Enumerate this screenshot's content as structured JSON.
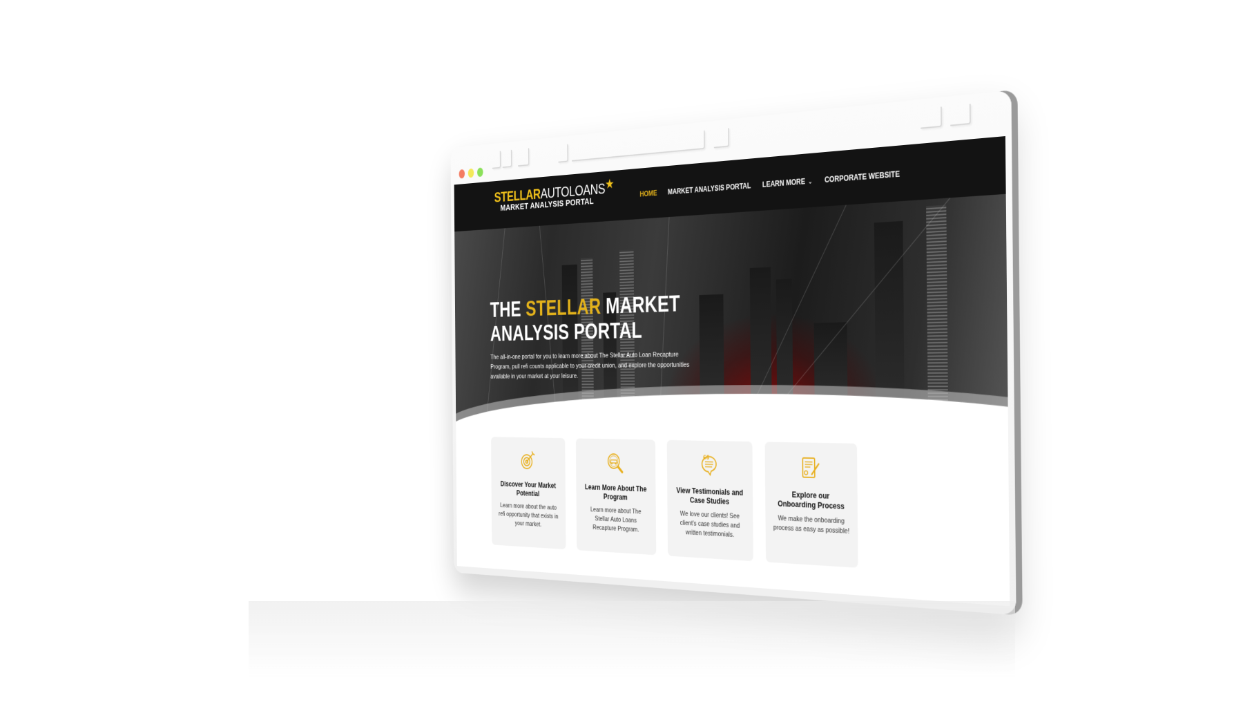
{
  "window": {
    "traffic_lights": [
      "close",
      "minimize",
      "maximize"
    ]
  },
  "nav": {
    "logo": {
      "brand_gold": "STELLAR",
      "brand_white": "AUTOLOANS",
      "star_icon": "★",
      "subtitle": "MARKET ANALYSIS PORTAL"
    },
    "items": [
      {
        "label": "HOME",
        "active": true
      },
      {
        "label": "MARKET ANALYSIS PORTAL",
        "active": false
      },
      {
        "label": "LEARN MORE",
        "active": false,
        "dropdown_icon": "⌄"
      },
      {
        "label": "CORPORATE WEBSITE",
        "active": false
      }
    ]
  },
  "hero": {
    "title_prefix": "THE ",
    "title_highlight": "STELLAR",
    "title_suffix": " MARKET ANALYSIS PORTAL",
    "subtitle": "The all-in-one portal for you to learn more about The Stellar Auto Loan Recapture Program, pull refi counts applicable to your credit union, and explore the opportunities available in your market at your leisure."
  },
  "cards": [
    {
      "icon": "target-icon",
      "title": "Discover Your Market Potential",
      "description": "Learn more about the auto refi opportunity that exists in your market."
    },
    {
      "icon": "magnifier-car-icon",
      "title": "Learn More About The Program",
      "description": "Learn more about The Stellar Auto Loans Recapture Program."
    },
    {
      "icon": "testimonial-bubble-icon",
      "title": "View Testimonials and Case Studies",
      "description": "We love our clients! See client's case studies and written testimonials."
    },
    {
      "icon": "contract-sign-icon",
      "title": "Explore our Onboarding Process",
      "description": "We make the onboarding process as easy as possible!"
    }
  ],
  "colors": {
    "accent_gold": "#e3b21b",
    "nav_bg": "#131313",
    "card_bg": "#f3f3f3"
  }
}
